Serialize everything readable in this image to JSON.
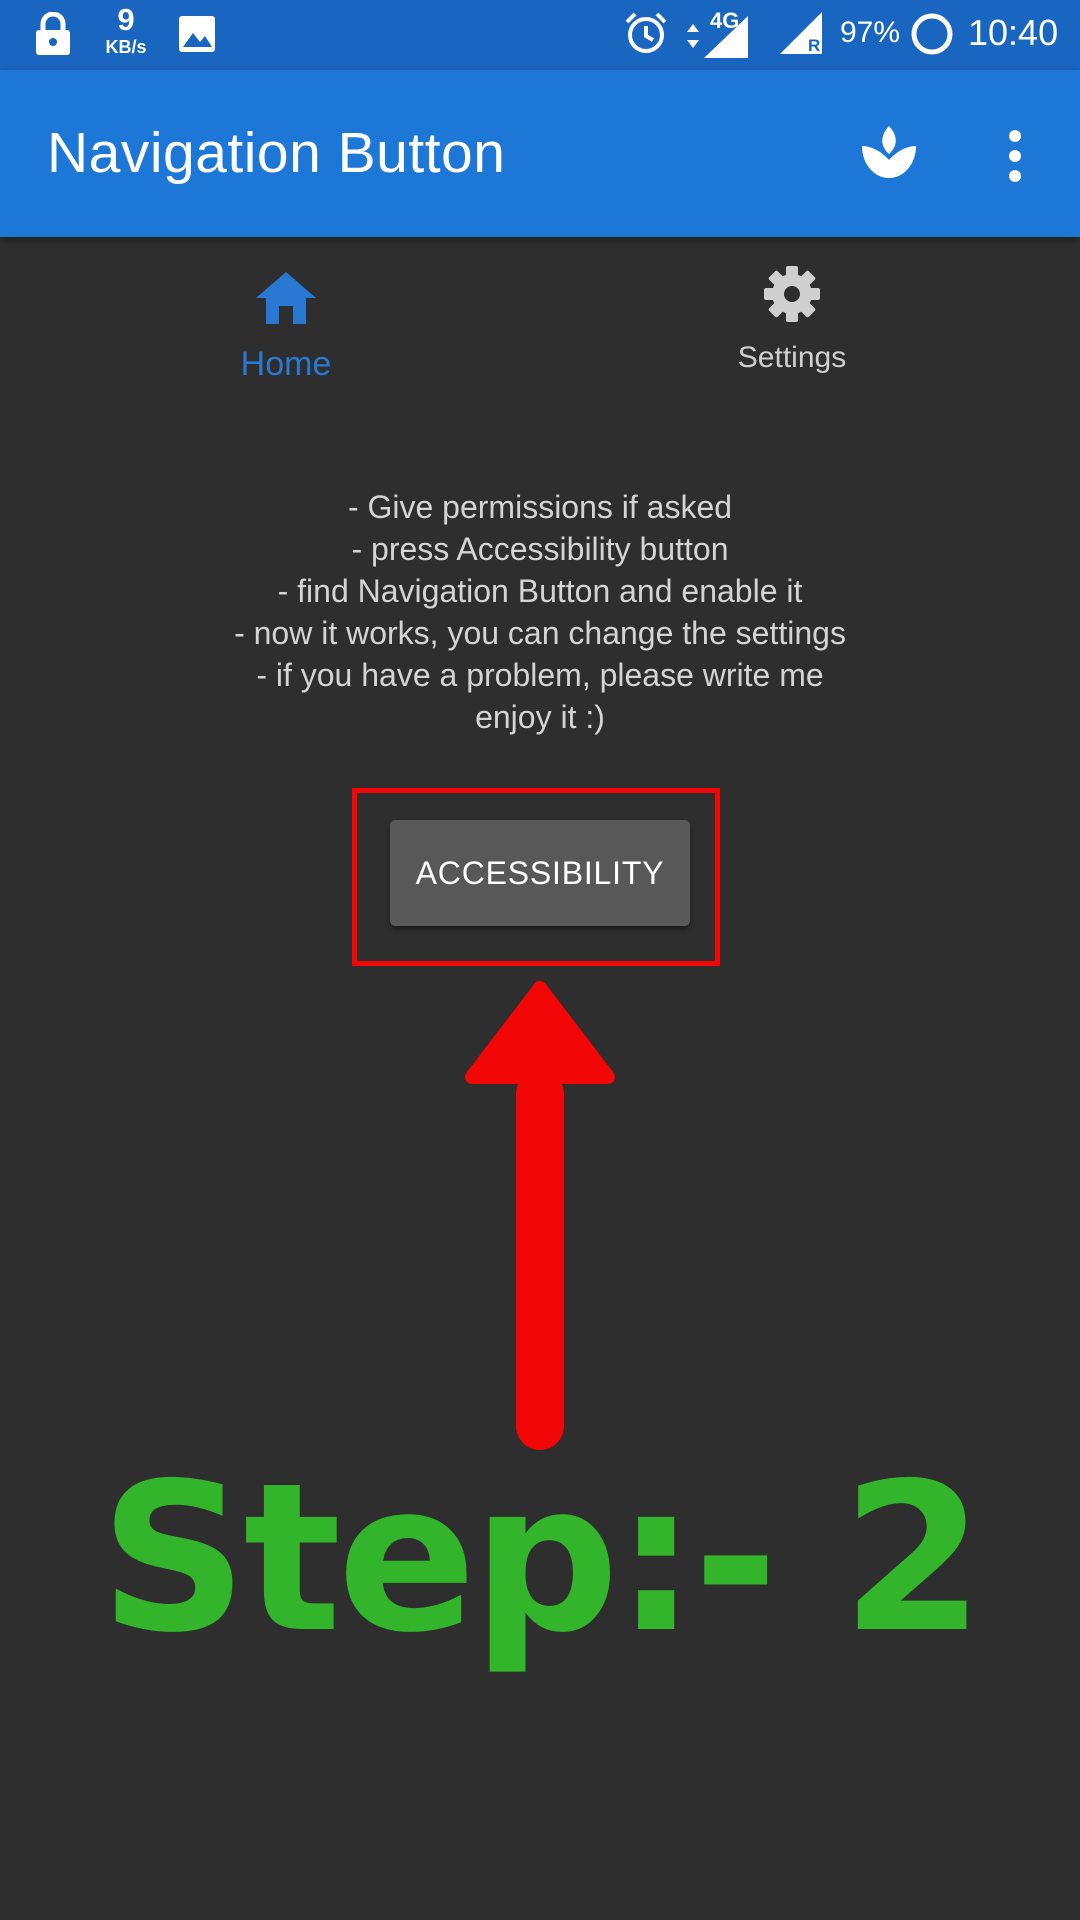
{
  "status_bar": {
    "speed_value": "9",
    "speed_unit": "KB/s",
    "network": "4G",
    "roaming": "R",
    "battery": "97%",
    "time": "10:40",
    "icons": [
      "lock-icon",
      "image-icon",
      "alarm-icon",
      "signal-icon",
      "battery-circle-icon"
    ]
  },
  "app_bar": {
    "title": "Navigation Button",
    "icons": [
      "leaf-icon",
      "more-vert-icon"
    ]
  },
  "tabs": [
    {
      "label": "Home",
      "icon": "home-icon",
      "active": true,
      "color": "#2979d4"
    },
    {
      "label": "Settings",
      "icon": "gear-icon",
      "active": false,
      "color": "#cfcfcf"
    }
  ],
  "instructions": [
    "- Give permissions if asked",
    "- press Accessibility button",
    "- find Navigation Button and enable it",
    "- now it works, you can change the settings",
    "- if you have a problem, please write me",
    "enjoy it :)"
  ],
  "accessibility_button": {
    "label": "ACCESSIBILITY"
  },
  "annotation": {
    "step_text": "Step:- 2",
    "arrow_color": "#f30606",
    "text_color": "#33b52b"
  },
  "colors": {
    "status_bar": "#1966c0",
    "app_bar": "#1c77d6",
    "background": "#2e2e2e"
  }
}
